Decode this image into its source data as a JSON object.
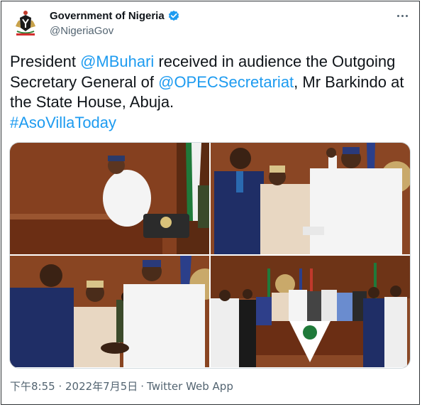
{
  "tweet": {
    "author": {
      "display_name": "Government of Nigeria",
      "handle": "@NigeriaGov",
      "avatar_icon": "nigeria-coat-of-arms-icon",
      "verified_icon": "verified-badge-icon"
    },
    "text": {
      "part1": "President ",
      "mention1": "@MBuhari",
      "part2": " received in audience the Outgoing Secretary General of ",
      "mention2": "@OPECSecretariat",
      "part3": ", Mr Barkindo at the State House, Abuja.",
      "hashtag": "#AsoVillaToday"
    },
    "media": [
      {
        "name": "photo-1"
      },
      {
        "name": "photo-2"
      },
      {
        "name": "photo-3"
      },
      {
        "name": "photo-4"
      }
    ],
    "timestamp": "下午8:55 · 2022年7月5日",
    "separator": "·",
    "source": "Twitter Web App"
  },
  "colors": {
    "link": "#1d9bf0",
    "verified": "#1d9bf0",
    "secondary_text": "#536471"
  }
}
